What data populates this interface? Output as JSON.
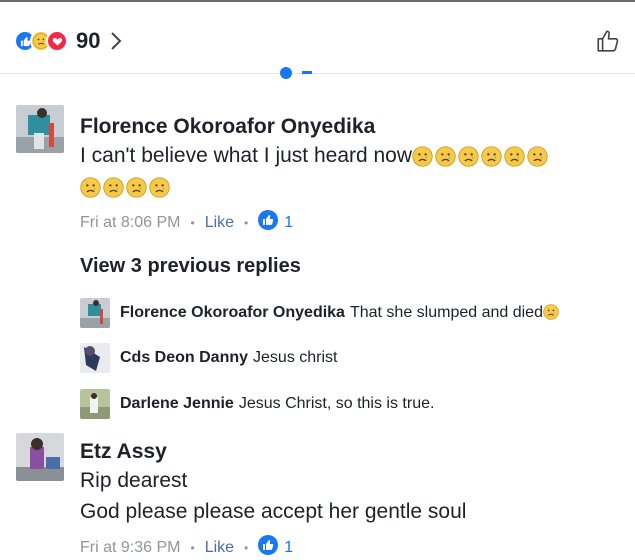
{
  "header": {
    "reaction_count": "90",
    "reaction_icons": [
      "like-icon",
      "sad-icon",
      "love-icon"
    ]
  },
  "comments": [
    {
      "author": "Florence Okoroafor Onyedika",
      "text": "I can't believe what I just heard now",
      "time": "Fri at 8:06 PM",
      "like_label": "Like",
      "like_count": "1",
      "emoji": "sad-emoji"
    },
    {
      "author": "Etz Assy",
      "line1": "Rip dearest",
      "line2": "God please please accept her gentle  soul",
      "time": "Fri at 9:36 PM",
      "like_label": "Like",
      "like_count": "1"
    }
  ],
  "replies_link": "View 3 previous replies",
  "replies": [
    {
      "author": "Florence Okoroafor Onyedika",
      "text": "That she slumped and died"
    },
    {
      "author": "Cds Deon Danny",
      "text": "Jesus christ"
    },
    {
      "author": "Darlene Jennie",
      "text": "Jesus Christ, so this is true."
    }
  ],
  "colors": {
    "brand_blue": "#1877f2",
    "sad_yellow": "#f7c948",
    "love_red": "#f0284a",
    "meta_gray": "#90949c"
  }
}
